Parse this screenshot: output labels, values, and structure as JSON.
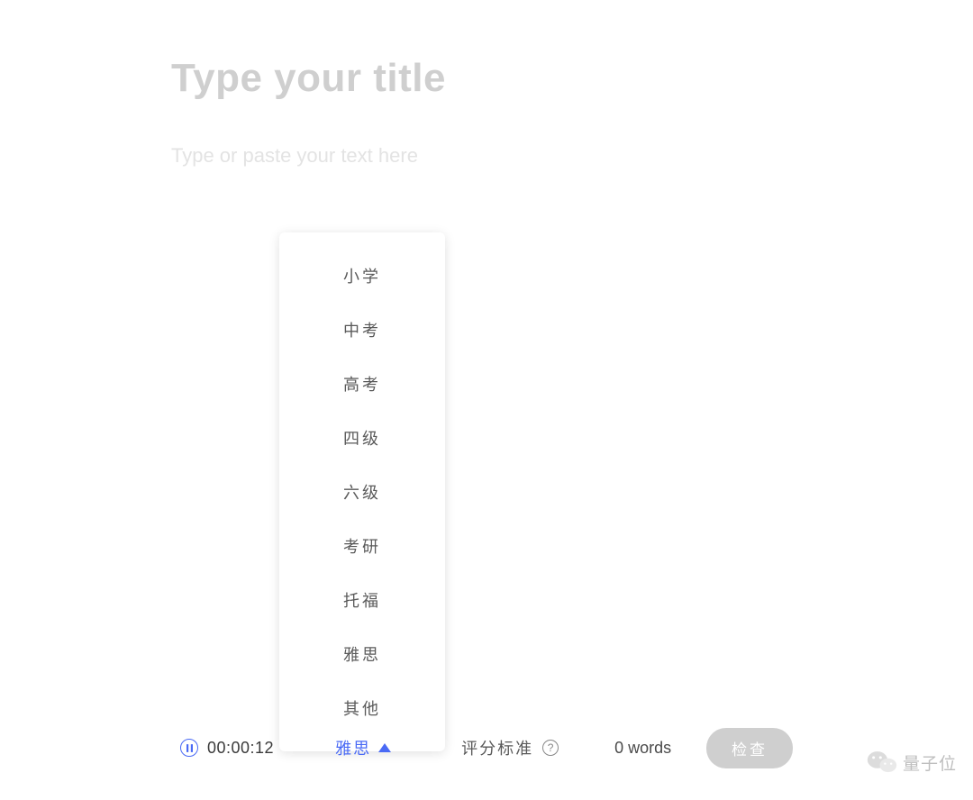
{
  "editor": {
    "title_placeholder": "Type your title",
    "body_placeholder": "Type or paste your text here"
  },
  "dropdown": {
    "items": [
      "小学",
      "中考",
      "高考",
      "四级",
      "六级",
      "考研",
      "托福",
      "雅思",
      "其他"
    ]
  },
  "toolbar": {
    "timer": "00:00:12",
    "selected_exam": "雅思",
    "grading_label": "评分标准",
    "word_count": "0 words",
    "check_button": "检查"
  },
  "watermark": {
    "text": "量子位"
  },
  "colors": {
    "accent": "#4a6af5",
    "placeholder_light": "#cfcfcf",
    "placeholder_lighter": "#e3e3e3",
    "text_gray": "#5a5a5a"
  }
}
